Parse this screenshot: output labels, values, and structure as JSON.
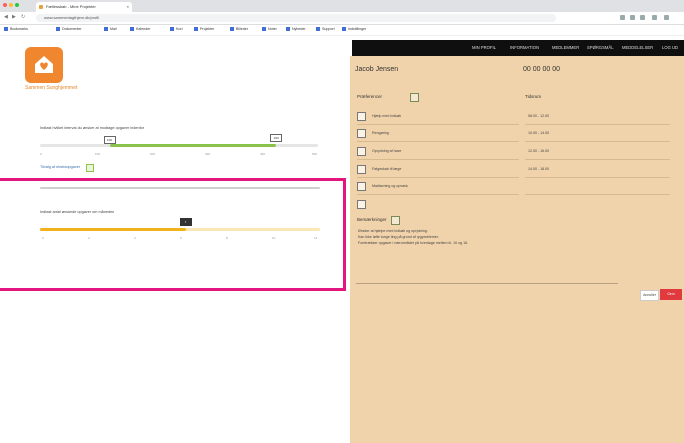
{
  "browser": {
    "tab_title": "Fællesskab - Mine Projekter",
    "tab_close": "×",
    "address": "www.sammenlagthjem.dk/profil",
    "bookmarks": [
      "Bookmarks",
      "Dokumenter",
      "Mail",
      "Kalender",
      "Kort",
      "Projekter",
      "Billeder",
      "Noter",
      "Nyheder",
      "Support",
      "Indstillinger"
    ]
  },
  "nav": {
    "items": [
      "MIN PROFIL",
      "INFORMATION",
      "MEDLEMMER",
      "SPØRGSMÅL",
      "MEDDELELSER",
      "LOG UD"
    ]
  },
  "logo": {
    "text": "Sammen Sunghjemmet"
  },
  "left": {
    "slider1_label": "Indtast hvilket interval du ønsker at modtage opgaver indenfor",
    "slider1_low": "100",
    "slider1_high": "400",
    "slider1_ticks": [
      "0",
      "100",
      "200",
      "300",
      "400",
      "500"
    ],
    "toggle_label": "Tilvalg af ekstraopgaver",
    "slider2_label": "Indtast antal ønskede opgaver om måneden",
    "slider2_value": "7",
    "slider2_ticks": [
      "0",
      "2",
      "4",
      "6",
      "8",
      "10",
      "12"
    ],
    "slider1_low_frac": 0.25,
    "slider1_high_frac": 0.85,
    "slider2_frac": 0.52
  },
  "right": {
    "name": "Jacob Jensen",
    "phone": "00 00 00 00",
    "section_title": "Præferencer",
    "time_title": "Tidsrum",
    "items": [
      "Hjælp med indkøb",
      "Rengøring",
      "Oprydning af have",
      "Følgeskab til læge",
      "Madlavning og opvask"
    ],
    "times": [
      "08.00 - 12.00",
      "10.00 - 14.00",
      "12.00 - 16.00",
      "14.00 - 18.00"
    ],
    "notes_title": "Bemærkninger",
    "notes": [
      "Ønsker at hjælpe med indkøb og oprydning.",
      "Kan ikke løfte tunge ting på grund af rygproblemer.",
      "Foretrækker opgaver i nærområdet på hverdage mellem kl. 10 og 16."
    ],
    "cancel": "Annuller",
    "save": "Gem"
  },
  "colors": {
    "accent_orange": "#f0862d",
    "green_track": "#8bc34a",
    "yellow_track": "#f2b21b",
    "panel": "#f1d3ab",
    "nav_dark": "#0f0f0f",
    "highlight": "#e3157f",
    "save": "#e03a3e"
  }
}
